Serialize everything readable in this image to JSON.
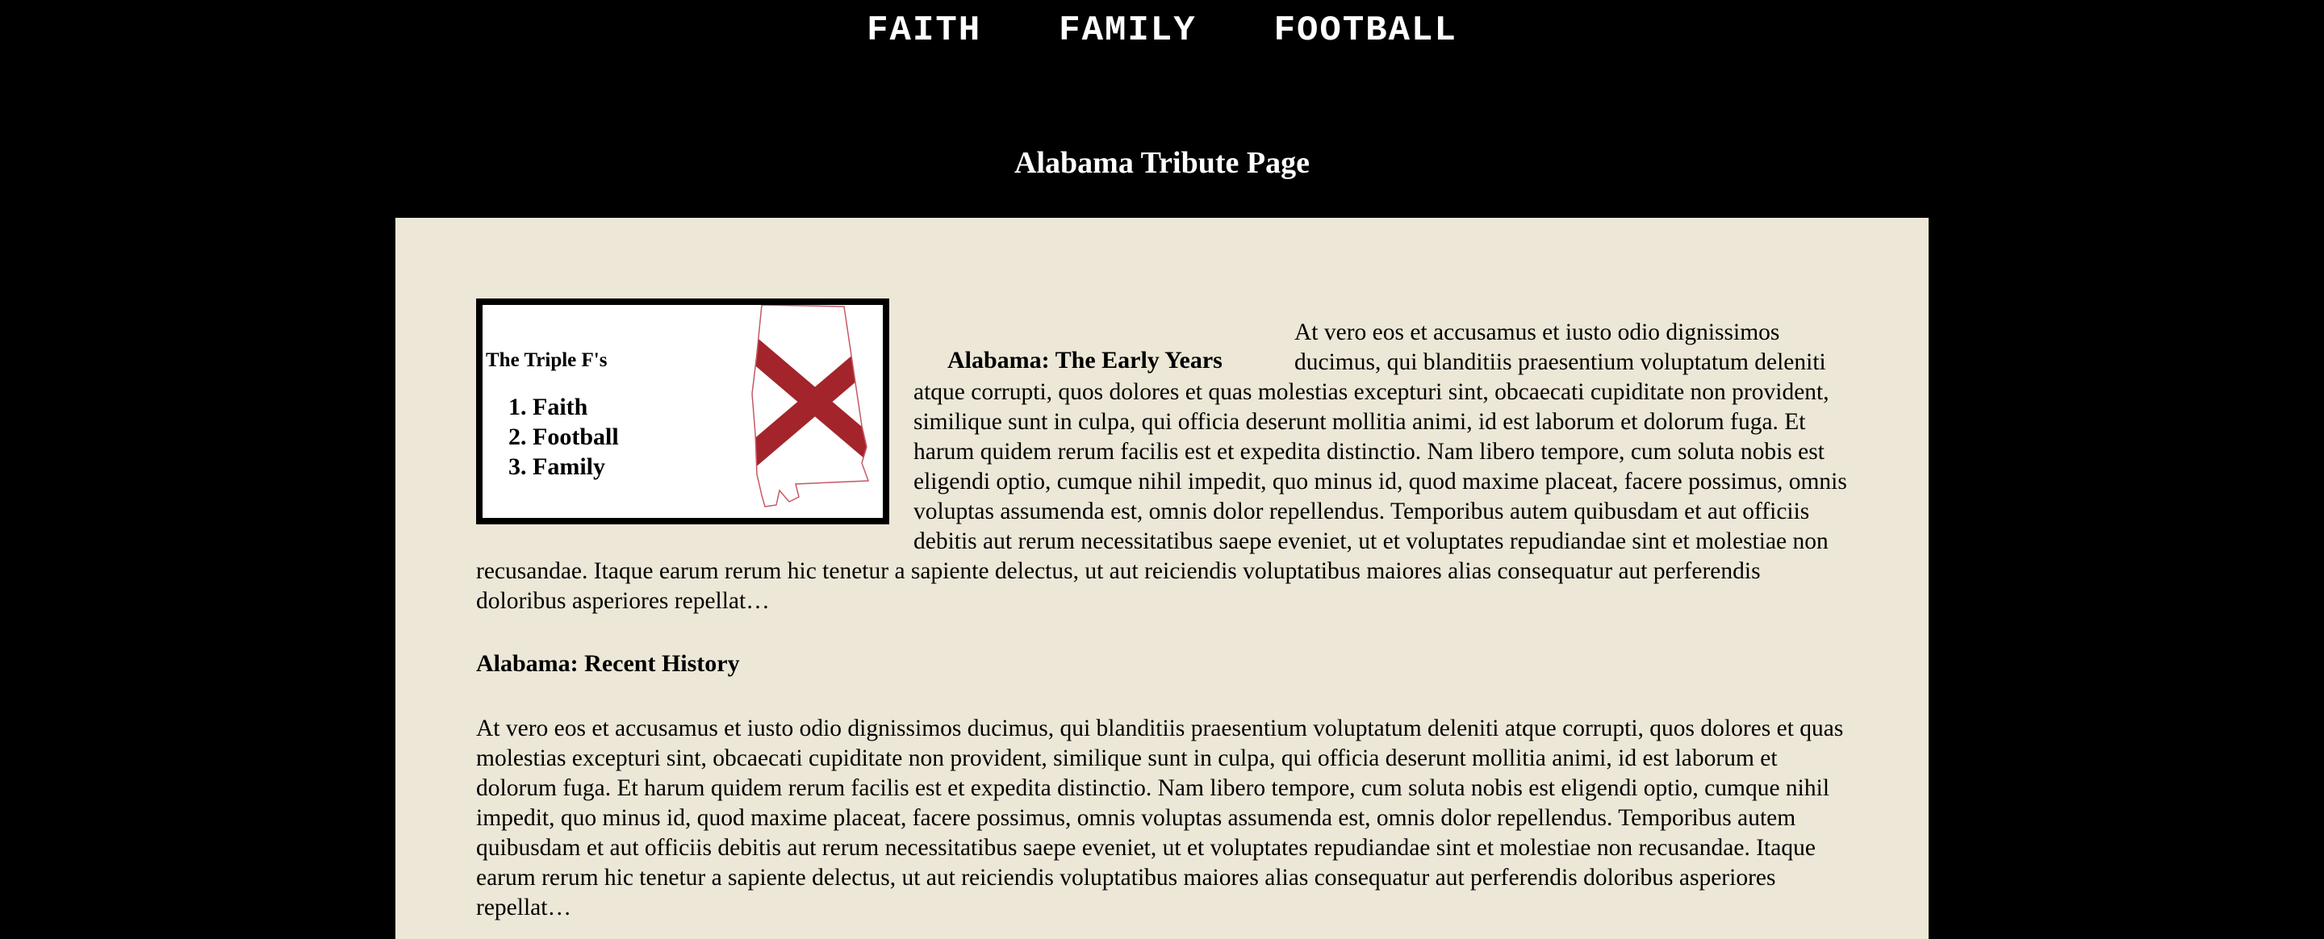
{
  "nav": {
    "items": [
      "FAITH",
      "FAMILY",
      "FOOTBALL"
    ]
  },
  "page": {
    "title": "Alabama Tribute Page"
  },
  "figure": {
    "title": "The Triple F's",
    "list": [
      "Faith",
      "Football",
      "Family"
    ],
    "image_icon": "alabama-state-flag-map-icon"
  },
  "sections": {
    "early": {
      "heading": "Alabama: The Early Years",
      "body": "At vero eos et accusamus et iusto odio dignissimos ducimus, qui blanditiis praesentium voluptatum deleniti atque corrupti, quos dolores et quas molestias excepturi sint, obcaecati cupiditate non provident, similique sunt in culpa, qui officia deserunt mollitia animi, id est laborum et dolorum fuga. Et harum quidem rerum facilis est et expedita distinctio. Nam libero tempore, cum soluta nobis est eligendi optio, cumque nihil impedit, quo minus id, quod maxime placeat, facere possimus, omnis voluptas assumenda est, omnis dolor repellendus. Temporibus autem quibusdam et aut officiis debitis aut rerum necessitatibus saepe eveniet, ut et voluptates repudiandae sint et molestiae non recusandae. Itaque earum rerum hic tenetur a sapiente delectus, ut aut reiciendis voluptatibus maiores alias consequatur aut perferendis doloribus asperiores repellat…"
    },
    "recent": {
      "heading": "Alabama: Recent History",
      "body": "At vero eos et accusamus et iusto odio dignissimos ducimus, qui blanditiis praesentium voluptatum deleniti atque corrupti, quos dolores et quas molestias excepturi sint, obcaecati cupiditate non provident, similique sunt in culpa, qui officia deserunt mollitia animi, id est laborum et dolorum fuga. Et harum quidem rerum facilis est et expedita distinctio. Nam libero tempore, cum soluta nobis est eligendi optio, cumque nihil impedit, quo minus id, quod maxime placeat, facere possimus, omnis voluptas assumenda est, omnis dolor repellendus. Temporibus autem quibusdam et aut officiis debitis aut rerum necessitatibus saepe eveniet, ut et voluptates repudiandae sint et molestiae non recusandae. Itaque earum rerum hic tenetur a sapiente delectus, ut aut reiciendis voluptatibus maiores alias consequatur aut perferendis doloribus asperiores repellat…"
    }
  },
  "colors": {
    "background": "#000000",
    "content_bg": "#ece7d6",
    "flag_red": "#a3242b"
  }
}
